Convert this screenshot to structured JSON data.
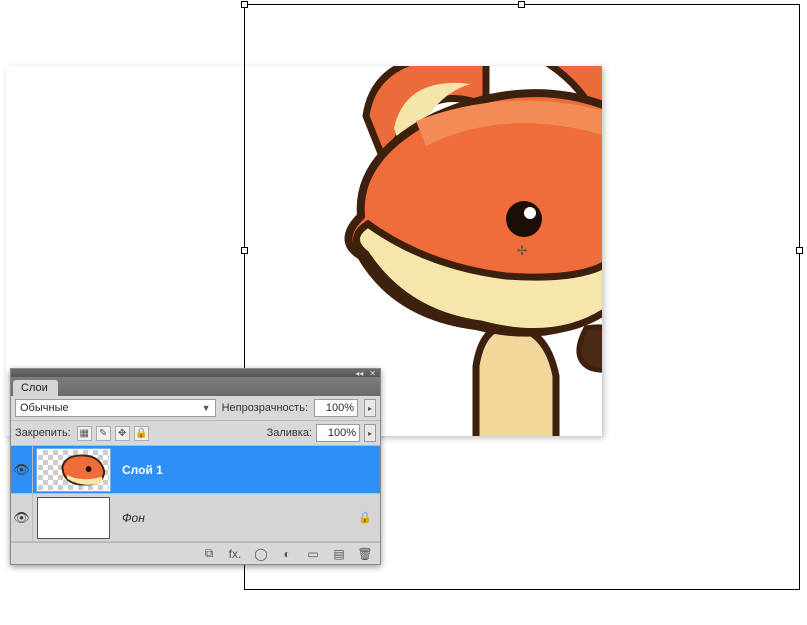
{
  "panel": {
    "tab": "Слои",
    "blend_label": "Обычные",
    "opacity_label": "Непрозрачность:",
    "opacity_value": "100%",
    "lock_label": "Закрепить:",
    "fill_label": "Заливка:",
    "fill_value": "100%"
  },
  "layers": [
    {
      "name": "Слой 1",
      "selected": true,
      "locked": false,
      "visible": true
    },
    {
      "name": "Фон",
      "selected": false,
      "locked": true,
      "visible": true
    }
  ],
  "icons": {
    "collapse": "◂◂",
    "close": "✕",
    "dropdown": "▼",
    "slider": "▸",
    "eye": "👁",
    "lock": "🔒",
    "link": "⧉",
    "fx": "fx.",
    "mask": "◯",
    "adjust": "◐",
    "group": "▭",
    "new": "▤",
    "trash": "🗑",
    "lock_transparent": "▦",
    "lock_brush": "✎",
    "lock_move": "✥",
    "lock_all": "🔒",
    "center": "✢"
  }
}
